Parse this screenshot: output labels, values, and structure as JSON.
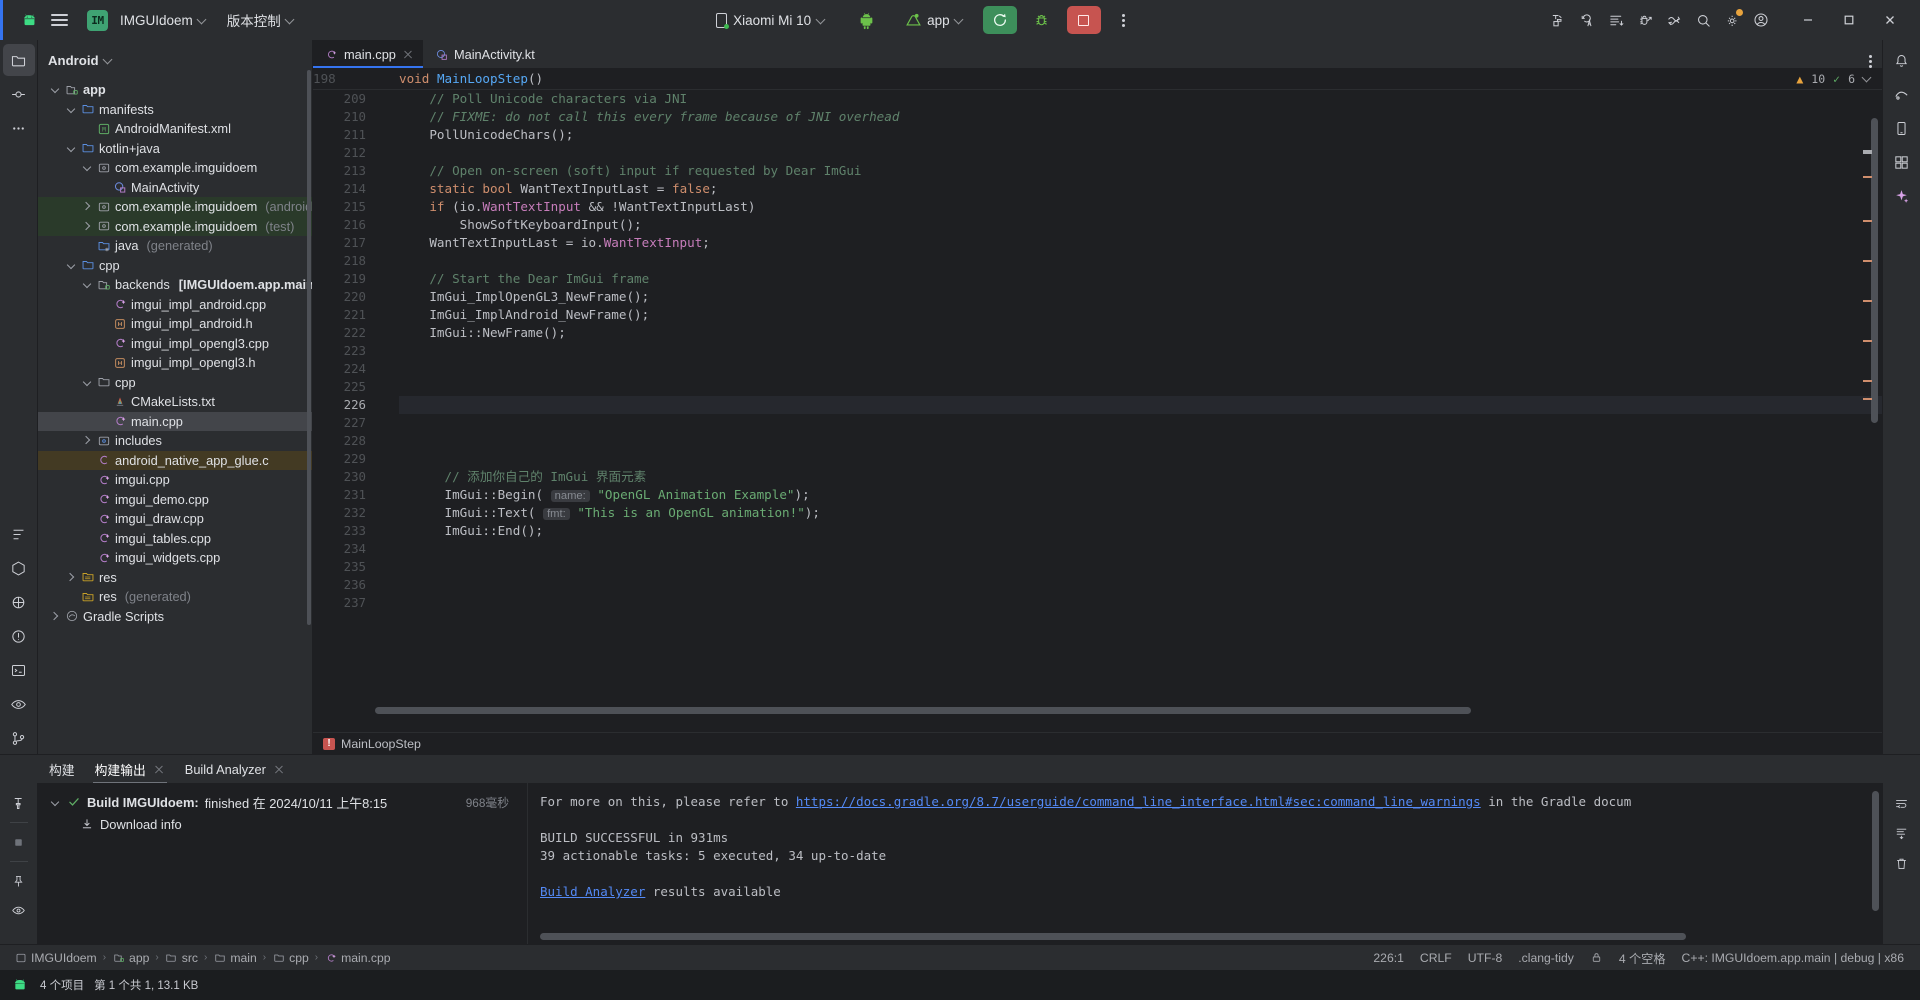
{
  "titlebar": {
    "android_logo_icon": "android-logo-icon",
    "menu_icon": "hamburger-menu-icon",
    "project_badge": "IM",
    "project_name": "IMGUIdoem",
    "vcs_label": "版本控制",
    "device_name": "Xiaomi Mi 10",
    "device_icon": "phone-icon",
    "emulator_icon": "android-robot-icon",
    "run_config_icon": "android-head-icon",
    "run_config_label": "app",
    "run_icon": "run-reload-icon",
    "debug_icon": "bug-icon",
    "stop_icon": "stop-square-icon",
    "more_icon": "kebab-more-icon",
    "right_icons": [
      "device-manager-icon",
      "code-with-me-icon",
      "logcat-icon",
      "app-inspection-icon",
      "profiler-icon",
      "search-icon",
      "settings-gear-icon",
      "account-icon"
    ],
    "minimize_icon": "minimize-icon",
    "maximize_icon": "maximize-icon",
    "close_icon": "close-icon"
  },
  "left_rail": {
    "icons": [
      "project-folder-icon",
      "commit-icon",
      "more-tools-icon",
      "structure-icon",
      "build-variants-icon",
      "device-explorer-icon",
      "problems-icon",
      "terminal-icon",
      "preview-icon",
      "git-icon"
    ]
  },
  "right_rail": {
    "icons": [
      "notifications-icon",
      "gradle-icon",
      "device-manager-panel-icon",
      "resource-manager-icon",
      "assistant-icon"
    ]
  },
  "project_panel": {
    "view_label": "Android",
    "chevron_icon": "chevron-down-icon",
    "tree": [
      {
        "depth": 0,
        "label": "app",
        "arrow": "down",
        "icon": "module-folder-icon",
        "bold": true,
        "state": "normal"
      },
      {
        "depth": 1,
        "label": "manifests",
        "arrow": "down",
        "icon": "folder-blue-icon",
        "bold": false,
        "state": "normal"
      },
      {
        "depth": 2,
        "label": "AndroidManifest.xml",
        "arrow": "none",
        "icon": "manifest-xml-icon",
        "bold": false,
        "state": "normal"
      },
      {
        "depth": 1,
        "label": "kotlin+java",
        "arrow": "down",
        "icon": "folder-blue-icon",
        "bold": false,
        "state": "normal"
      },
      {
        "depth": 2,
        "label": "com.example.imguidoem",
        "arrow": "down",
        "icon": "package-icon",
        "bold": false,
        "state": "normal"
      },
      {
        "depth": 3,
        "label": "MainActivity",
        "arrow": "none",
        "icon": "kotlin-class-icon",
        "bold": false,
        "state": "normal"
      },
      {
        "depth": 2,
        "label": "com.example.imguidoem",
        "sub": "(androidTest)",
        "arrow": "right",
        "icon": "package-icon",
        "bold": false,
        "state": "green"
      },
      {
        "depth": 2,
        "label": "com.example.imguidoem",
        "sub": "(test)",
        "arrow": "right",
        "icon": "package-icon",
        "bold": false,
        "state": "green"
      },
      {
        "depth": 2,
        "label": "java",
        "sub": "(generated)",
        "arrow": "none",
        "icon": "folder-generated-icon",
        "bold": false,
        "state": "normal"
      },
      {
        "depth": 1,
        "label": "cpp",
        "arrow": "down",
        "icon": "folder-blue-icon",
        "bold": false,
        "state": "normal"
      },
      {
        "depth": 2,
        "label": "backends",
        "sub2": "[IMGUIdoem.app.main]",
        "arrow": "down",
        "icon": "module-folder-icon",
        "bold": false,
        "state": "normal"
      },
      {
        "depth": 3,
        "label": "imgui_impl_android.cpp",
        "arrow": "none",
        "icon": "cpp-file-icon",
        "bold": false,
        "state": "normal"
      },
      {
        "depth": 3,
        "label": "imgui_impl_android.h",
        "arrow": "none",
        "icon": "header-file-icon",
        "bold": false,
        "state": "normal"
      },
      {
        "depth": 3,
        "label": "imgui_impl_opengl3.cpp",
        "arrow": "none",
        "icon": "cpp-file-icon",
        "bold": false,
        "state": "normal"
      },
      {
        "depth": 3,
        "label": "imgui_impl_opengl3.h",
        "arrow": "none",
        "icon": "header-file-icon",
        "bold": false,
        "state": "normal"
      },
      {
        "depth": 2,
        "label": "cpp",
        "arrow": "down",
        "icon": "folder-gray-icon",
        "bold": false,
        "state": "normal"
      },
      {
        "depth": 3,
        "label": "CMakeLists.txt",
        "arrow": "none",
        "icon": "cmake-icon",
        "bold": false,
        "state": "normal"
      },
      {
        "depth": 3,
        "label": "main.cpp",
        "arrow": "none",
        "icon": "cpp-file-icon",
        "bold": false,
        "state": "selected"
      },
      {
        "depth": 2,
        "label": "includes",
        "arrow": "right",
        "icon": "includes-icon",
        "bold": false,
        "state": "normal"
      },
      {
        "depth": 2,
        "label": "android_native_app_glue.c",
        "arrow": "none",
        "icon": "c-file-icon",
        "bold": false,
        "state": "brown"
      },
      {
        "depth": 2,
        "label": "imgui.cpp",
        "arrow": "none",
        "icon": "cpp-file-icon",
        "bold": false,
        "state": "normal"
      },
      {
        "depth": 2,
        "label": "imgui_demo.cpp",
        "arrow": "none",
        "icon": "cpp-file-icon",
        "bold": false,
        "state": "normal"
      },
      {
        "depth": 2,
        "label": "imgui_draw.cpp",
        "arrow": "none",
        "icon": "cpp-file-icon",
        "bold": false,
        "state": "normal"
      },
      {
        "depth": 2,
        "label": "imgui_tables.cpp",
        "arrow": "none",
        "icon": "cpp-file-icon",
        "bold": false,
        "state": "normal"
      },
      {
        "depth": 2,
        "label": "imgui_widgets.cpp",
        "arrow": "none",
        "icon": "cpp-file-icon",
        "bold": false,
        "state": "normal"
      },
      {
        "depth": 1,
        "label": "res",
        "arrow": "right",
        "icon": "res-folder-icon",
        "bold": false,
        "state": "normal"
      },
      {
        "depth": 1,
        "label": "res",
        "sub": "(generated)",
        "arrow": "none",
        "icon": "res-folder-icon",
        "bold": false,
        "state": "normal"
      },
      {
        "depth": 0,
        "label": "Gradle Scripts",
        "arrow": "right",
        "icon": "gradle-script-icon",
        "bold": false,
        "state": "normal"
      }
    ]
  },
  "editor": {
    "tabs": [
      {
        "label": "main.cpp",
        "icon": "cpp-file-icon",
        "active": true,
        "closable": true
      },
      {
        "label": "MainActivity.kt",
        "icon": "kotlin-class-icon",
        "active": false,
        "closable": false
      }
    ],
    "tab_options_icon": "kebab-more-icon",
    "sticky_line_number": "198",
    "sticky_code_kw": "void",
    "sticky_code_fn": "MainLoopStep",
    "sticky_code_tail": "()",
    "inspection": {
      "warning_icon": "warning-triangle-icon",
      "warning_count": "10",
      "check_icon": "check-icon",
      "check_count": "6",
      "expand_icon": "chevron-down-icon"
    },
    "lines": [
      {
        "n": "209",
        "tokens": [
          {
            "t": "    // Poll Unicode characters via JNI",
            "c": "c-cmt"
          }
        ]
      },
      {
        "n": "210",
        "tokens": [
          {
            "t": "    // ",
            "c": "c-cmt"
          },
          {
            "t": "FIXME: do not call this every frame because of JNI overhead",
            "c": "c-cmt-i"
          }
        ]
      },
      {
        "n": "211",
        "tokens": [
          {
            "t": "    PollUnicodeChars();",
            "c": "c-txt"
          }
        ]
      },
      {
        "n": "212",
        "tokens": []
      },
      {
        "n": "213",
        "tokens": [
          {
            "t": "    // Open on-screen (soft) input if requested by Dear ImGui",
            "c": "c-cmt"
          }
        ]
      },
      {
        "n": "214",
        "tokens": [
          {
            "t": "    ",
            "c": "c-txt"
          },
          {
            "t": "static bool",
            "c": "c-kw"
          },
          {
            "t": " WantTextInputLast = ",
            "c": "c-txt"
          },
          {
            "t": "false",
            "c": "c-kw"
          },
          {
            "t": ";",
            "c": "c-txt"
          }
        ]
      },
      {
        "n": "215",
        "tokens": [
          {
            "t": "    ",
            "c": "c-txt"
          },
          {
            "t": "if",
            "c": "c-kw"
          },
          {
            "t": " (io.",
            "c": "c-txt"
          },
          {
            "t": "WantTextInput",
            "c": "c-fld"
          },
          {
            "t": " && !WantTextInputLast)",
            "c": "c-txt"
          }
        ]
      },
      {
        "n": "216",
        "tokens": [
          {
            "t": "        ShowSoftKeyboardInput();",
            "c": "c-txt"
          }
        ]
      },
      {
        "n": "217",
        "tokens": [
          {
            "t": "    WantTextInputLast = io.",
            "c": "c-txt"
          },
          {
            "t": "WantTextInput",
            "c": "c-fld"
          },
          {
            "t": ";",
            "c": "c-txt"
          }
        ]
      },
      {
        "n": "218",
        "tokens": []
      },
      {
        "n": "219",
        "tokens": [
          {
            "t": "    // Start the Dear ImGui frame",
            "c": "c-cmt"
          }
        ]
      },
      {
        "n": "220",
        "tokens": [
          {
            "t": "    ImGui_ImplOpenGL3_NewFrame();",
            "c": "c-txt"
          }
        ]
      },
      {
        "n": "221",
        "tokens": [
          {
            "t": "    ImGui_ImplAndroid_NewFrame();",
            "c": "c-txt"
          }
        ]
      },
      {
        "n": "222",
        "tokens": [
          {
            "t": "    ImGui::NewFrame();",
            "c": "c-txt"
          }
        ]
      },
      {
        "n": "223",
        "tokens": []
      },
      {
        "n": "224",
        "tokens": []
      },
      {
        "n": "225",
        "tokens": []
      },
      {
        "n": "226",
        "tokens": [],
        "current": true
      },
      {
        "n": "227",
        "tokens": []
      },
      {
        "n": "228",
        "tokens": []
      },
      {
        "n": "229",
        "tokens": []
      },
      {
        "n": "230",
        "tokens": [
          {
            "t": "      // 添加你自己的 ImGui 界面元素",
            "c": "c-cmt"
          }
        ]
      },
      {
        "n": "231",
        "tokens": [
          {
            "t": "      ImGui::Begin( ",
            "c": "c-txt"
          },
          {
            "t": "name:",
            "c": "c-hint"
          },
          {
            "t": " ",
            "c": "c-txt"
          },
          {
            "t": "\"OpenGL Animation Example\"",
            "c": "c-str"
          },
          {
            "t": ");",
            "c": "c-txt"
          }
        ]
      },
      {
        "n": "232",
        "tokens": [
          {
            "t": "      ImGui::Text( ",
            "c": "c-txt"
          },
          {
            "t": "fmt:",
            "c": "c-hint"
          },
          {
            "t": " ",
            "c": "c-txt"
          },
          {
            "t": "\"This is an OpenGL animation!\"",
            "c": "c-str"
          },
          {
            "t": ");",
            "c": "c-txt"
          }
        ]
      },
      {
        "n": "233",
        "tokens": [
          {
            "t": "      ImGui::End();",
            "c": "c-txt"
          }
        ]
      },
      {
        "n": "234",
        "tokens": []
      },
      {
        "n": "235",
        "tokens": []
      },
      {
        "n": "236",
        "tokens": []
      },
      {
        "n": "237",
        "tokens": []
      }
    ],
    "breadcrumb_icon": "error-marker-icon",
    "breadcrumb_label": "MainLoopStep"
  },
  "bottom_panel": {
    "tabs": [
      {
        "label": "构建",
        "active": false,
        "closable": false
      },
      {
        "label": "构建输出",
        "active": true,
        "closable": true
      },
      {
        "label": "Build Analyzer",
        "active": false,
        "closable": true
      }
    ],
    "side_icons": [
      "build-hammer-icon",
      "stop-icon",
      "pin-icon",
      "eye-icon"
    ],
    "tree": [
      {
        "arrow": "down",
        "status_icon": "check-green-icon",
        "label_bold": "Build IMGUIdoem:",
        "label": " finished 在 2024/10/11 上午8:15",
        "duration": "968毫秒"
      },
      {
        "arrow": "none",
        "status_icon": "download-icon",
        "label_bold": "",
        "label": "Download info",
        "duration": ""
      }
    ],
    "console": [
      {
        "segments": [
          {
            "t": "For more on this, please refer to ",
            "k": "plain"
          },
          {
            "t": "https://docs.gradle.org/8.7/userguide/command_line_interface.html#sec:command_line_warnings",
            "k": "link"
          },
          {
            "t": " in the Gradle docum",
            "k": "plain"
          }
        ]
      },
      {
        "segments": []
      },
      {
        "segments": [
          {
            "t": "BUILD SUCCESSFUL in 931ms",
            "k": "plain"
          }
        ]
      },
      {
        "segments": [
          {
            "t": "39 actionable tasks: 5 executed, 34 up-to-date",
            "k": "plain"
          }
        ]
      },
      {
        "segments": []
      },
      {
        "segments": [
          {
            "t": "Build Analyzer",
            "k": "link"
          },
          {
            "t": " results available",
            "k": "plain"
          }
        ]
      }
    ],
    "right_icons": [
      "soft-wrap-icon",
      "scroll-end-icon",
      "trash-icon"
    ]
  },
  "status_bar": {
    "breadcrumbs": [
      {
        "label": "IMGUIdoem",
        "icon": "project-icon"
      },
      {
        "label": "app",
        "icon": "module-icon"
      },
      {
        "label": "src",
        "icon": "folder-icon"
      },
      {
        "label": "main",
        "icon": "folder-icon"
      },
      {
        "label": "cpp",
        "icon": "folder-icon"
      },
      {
        "label": "main.cpp",
        "icon": "cpp-file-icon"
      }
    ],
    "caret": "226:1",
    "line_sep": "CRLF",
    "encoding": "UTF-8",
    "lint": ".clang-tidy",
    "lock_icon": "lock-icon",
    "indent": "4 个空格",
    "toolchain": "C++: IMGUIdoem.app.main | debug | x86"
  },
  "taskbar": {
    "items": [
      "4 个项目",
      "第 1 个共 1, 13.1 KB"
    ]
  },
  "colors": {
    "accent_blue": "#3574f0",
    "run_green": "#3d8f5b",
    "stop_red": "#c75450",
    "bg_dark": "#1e1f22",
    "bg_panel": "#2b2d30",
    "string_green": "#6aab73",
    "comment_green": "#5f826b",
    "keyword_orange": "#cf8e6d"
  }
}
